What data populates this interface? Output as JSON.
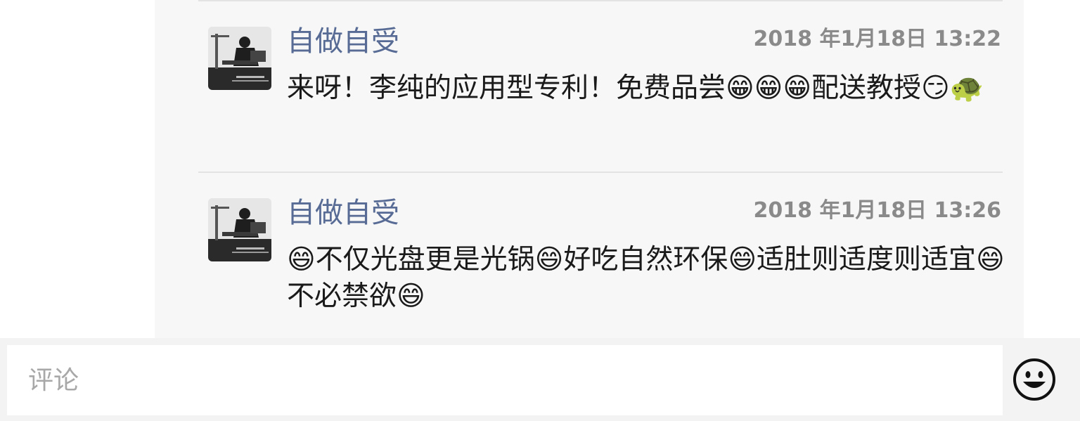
{
  "comments": [
    {
      "author": "自做自受",
      "time": "2018 年1月18日 13:22",
      "text": "来呀！李纯的应用型专利！免费品尝😁😁😁配送教授😏🐢"
    },
    {
      "author": "自做自受",
      "time": "2018 年1月18日 13:26",
      "text": "😄不仅光盘更是光锅😄好吃自然环保😄适肚则适度则适宜😄不必禁欲😄"
    }
  ],
  "input": {
    "placeholder": "评论"
  },
  "icons": {
    "emoji_button": "smiley-face-icon"
  },
  "colors": {
    "author": "#576b95",
    "panel": "#f7f7f7",
    "timestamp": "#8a8a8a"
  }
}
